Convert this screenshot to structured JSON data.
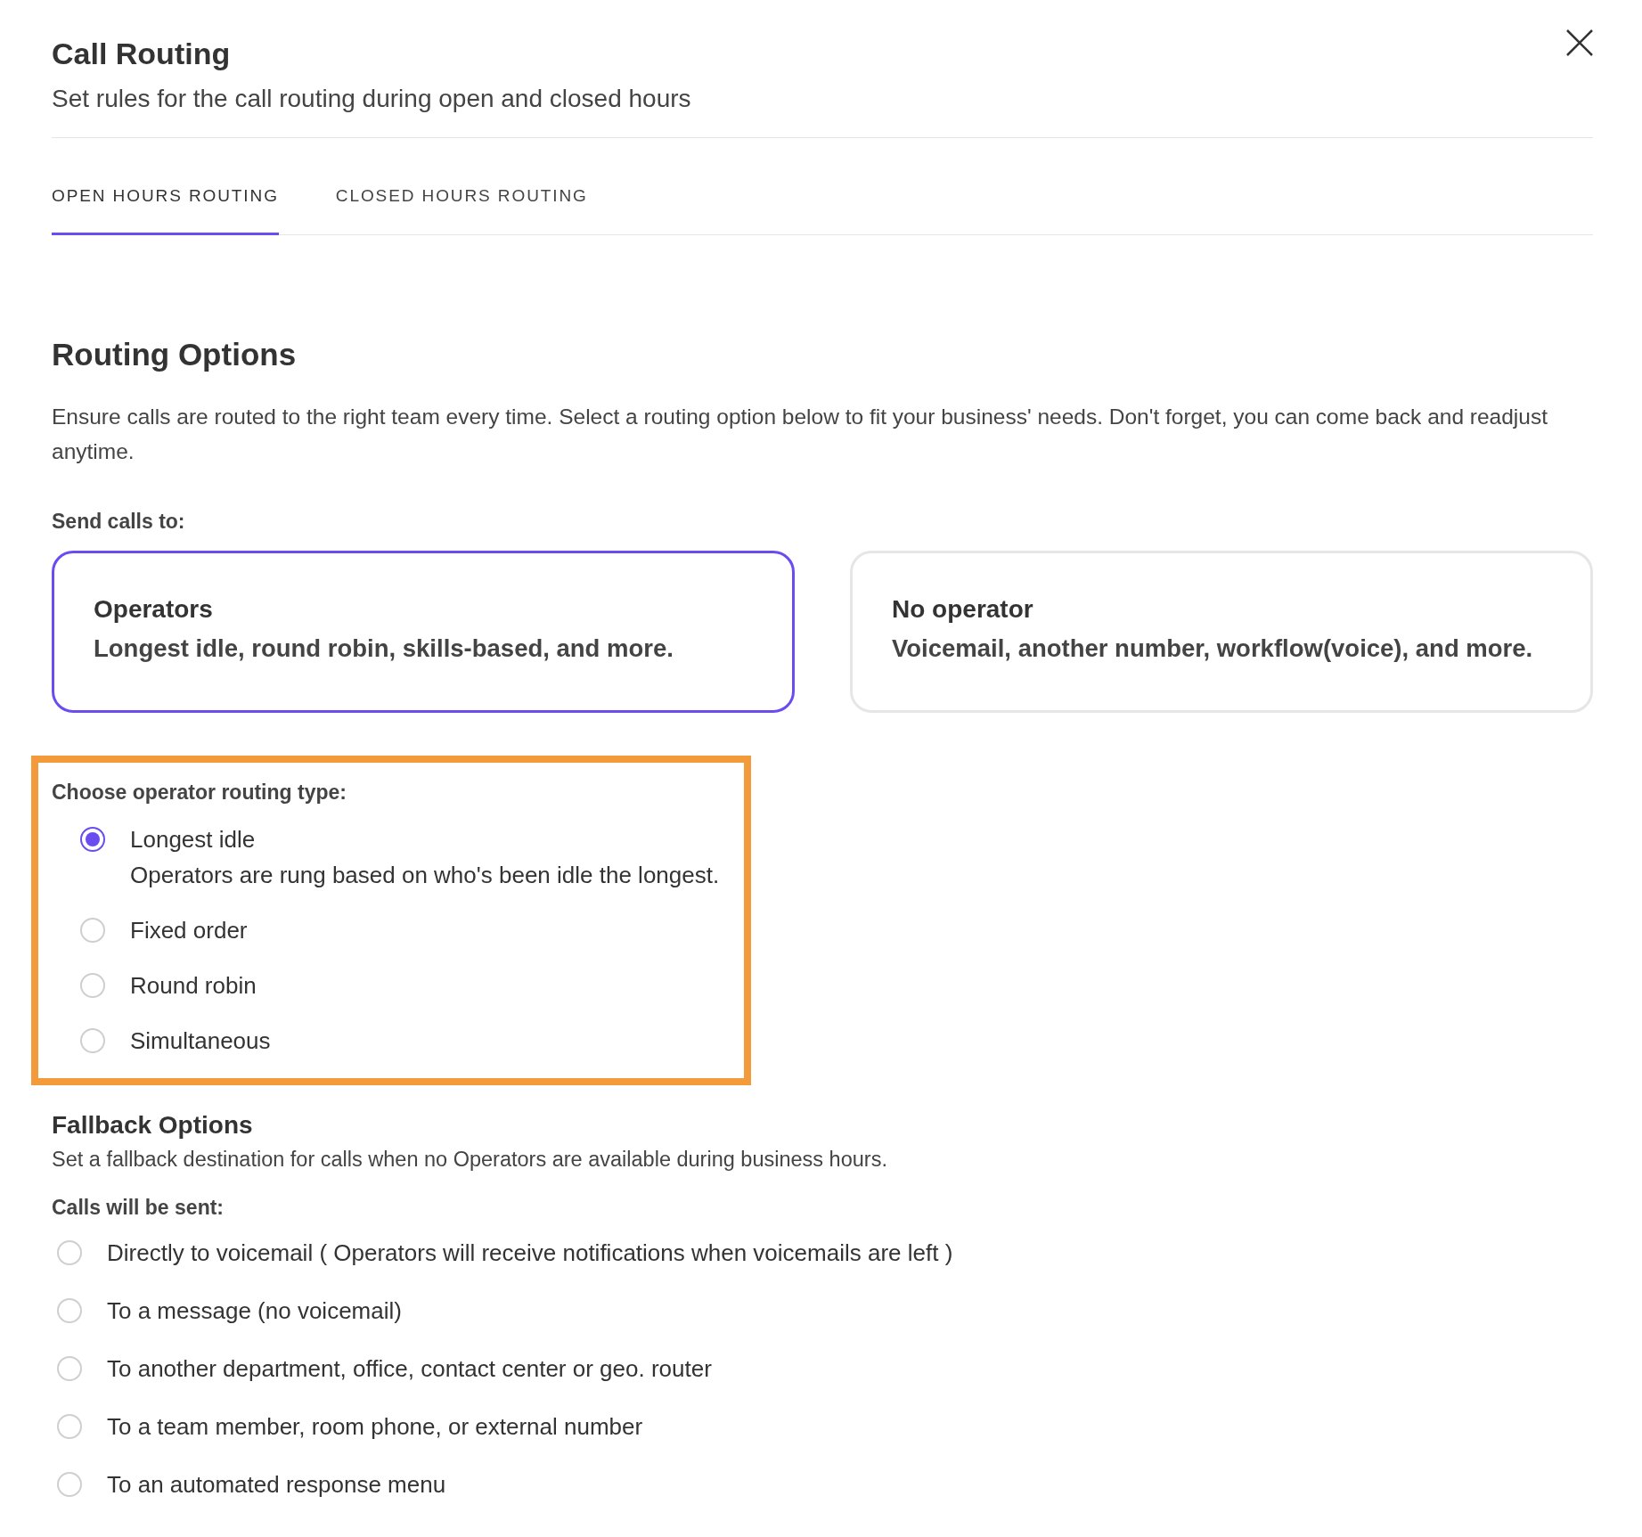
{
  "header": {
    "title": "Call Routing",
    "subtitle": "Set rules for the call routing during open and closed hours"
  },
  "tabs": [
    {
      "label": "OPEN HOURS ROUTING",
      "selected": true
    },
    {
      "label": "CLOSED HOURS ROUTING",
      "selected": false
    }
  ],
  "routing_options": {
    "title": "Routing Options",
    "description": "Ensure calls are routed to the right team every time. Select a routing option below to fit your business' needs. Don't forget, you can come back and readjust anytime.",
    "send_label": "Send calls to:",
    "cards": [
      {
        "title": "Operators",
        "description": "Longest idle, round robin, skills-based, and more.",
        "selected": true
      },
      {
        "title": "No operator",
        "description": "Voicemail, another number, workflow(voice), and more.",
        "selected": false
      }
    ]
  },
  "operator_routing": {
    "label": "Choose operator routing type:",
    "options": [
      {
        "label": "Longest idle",
        "description": "Operators are rung based on who's been idle the longest.",
        "selected": true
      },
      {
        "label": "Fixed order",
        "selected": false
      },
      {
        "label": "Round robin",
        "selected": false
      },
      {
        "label": "Simultaneous",
        "selected": false
      }
    ]
  },
  "fallback": {
    "title": "Fallback Options",
    "description": "Set a fallback destination for calls when no Operators are available during business hours.",
    "sent_label": "Calls will be sent:",
    "options": [
      {
        "label": "Directly to voicemail ( Operators will receive notifications when voicemails are left )",
        "selected": false
      },
      {
        "label": "To a message (no voicemail)",
        "selected": false
      },
      {
        "label": "To another department, office, contact center or geo. router",
        "selected": false
      },
      {
        "label": "To a team member, room phone, or external number",
        "selected": false
      },
      {
        "label": "To an automated response menu",
        "selected": false
      }
    ]
  }
}
